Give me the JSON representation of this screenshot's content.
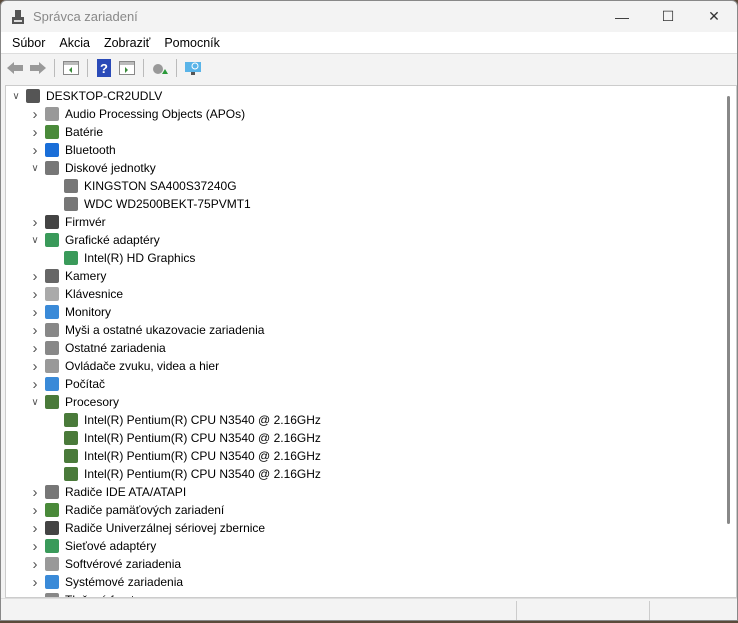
{
  "window": {
    "title": "Správca zariadení"
  },
  "menu": [
    "Súbor",
    "Akcia",
    "Zobraziť",
    "Pomocník"
  ],
  "toolbar": [
    "back-icon",
    "forward-icon",
    "show-hide-console-tree-icon",
    "help-icon",
    "action-pane-icon",
    "update-driver-icon",
    "scan-hardware-icon"
  ],
  "tree": [
    {
      "label": "DESKTOP-CR2UDLV",
      "level": 0,
      "exp": "open",
      "icon": "computer-icon",
      "color": "#555"
    },
    {
      "label": "Audio Processing Objects (APOs)",
      "level": 1,
      "exp": "closed",
      "icon": "speaker-icon",
      "color": "#999"
    },
    {
      "label": "Batérie",
      "level": 1,
      "exp": "closed",
      "icon": "battery-icon",
      "color": "#4a8a3a"
    },
    {
      "label": "Bluetooth",
      "level": 1,
      "exp": "closed",
      "icon": "bluetooth-icon",
      "color": "#1a6ed8"
    },
    {
      "label": "Diskové jednotky",
      "level": 1,
      "exp": "open",
      "icon": "disk-icon",
      "color": "#777"
    },
    {
      "label": "KINGSTON SA400S37240G",
      "level": 2,
      "exp": "",
      "icon": "disk-icon",
      "color": "#777"
    },
    {
      "label": "WDC WD2500BEKT-75PVMT1",
      "level": 2,
      "exp": "",
      "icon": "disk-icon",
      "color": "#777"
    },
    {
      "label": "Firmvér",
      "level": 1,
      "exp": "closed",
      "icon": "firmware-icon",
      "color": "#444"
    },
    {
      "label": "Grafické adaptéry",
      "level": 1,
      "exp": "open",
      "icon": "display-adapter-icon",
      "color": "#3a9a5a"
    },
    {
      "label": "Intel(R) HD Graphics",
      "level": 2,
      "exp": "",
      "icon": "display-adapter-icon",
      "color": "#3a9a5a"
    },
    {
      "label": "Kamery",
      "level": 1,
      "exp": "closed",
      "icon": "camera-icon",
      "color": "#666"
    },
    {
      "label": "Klávesnice",
      "level": 1,
      "exp": "closed",
      "icon": "keyboard-icon",
      "color": "#aaa"
    },
    {
      "label": "Monitory",
      "level": 1,
      "exp": "closed",
      "icon": "monitor-icon",
      "color": "#3a8ad8"
    },
    {
      "label": "Myši a ostatné ukazovacie zariadenia",
      "level": 1,
      "exp": "closed",
      "icon": "mouse-icon",
      "color": "#888"
    },
    {
      "label": "Ostatné zariadenia",
      "level": 1,
      "exp": "closed",
      "icon": "unknown-device-icon",
      "color": "#888"
    },
    {
      "label": "Ovládače zvuku, videa a hier",
      "level": 1,
      "exp": "closed",
      "icon": "speaker-icon",
      "color": "#999"
    },
    {
      "label": "Počítač",
      "level": 1,
      "exp": "closed",
      "icon": "monitor-icon",
      "color": "#3a8ad8"
    },
    {
      "label": "Procesory",
      "level": 1,
      "exp": "open",
      "icon": "cpu-icon",
      "color": "#4a7a3a"
    },
    {
      "label": "Intel(R) Pentium(R) CPU  N3540  @ 2.16GHz",
      "level": 2,
      "exp": "",
      "icon": "cpu-icon",
      "color": "#4a7a3a"
    },
    {
      "label": "Intel(R) Pentium(R) CPU  N3540  @ 2.16GHz",
      "level": 2,
      "exp": "",
      "icon": "cpu-icon",
      "color": "#4a7a3a"
    },
    {
      "label": "Intel(R) Pentium(R) CPU  N3540  @ 2.16GHz",
      "level": 2,
      "exp": "",
      "icon": "cpu-icon",
      "color": "#4a7a3a"
    },
    {
      "label": "Intel(R) Pentium(R) CPU  N3540  @ 2.16GHz",
      "level": 2,
      "exp": "",
      "icon": "cpu-icon",
      "color": "#4a7a3a"
    },
    {
      "label": "Radiče IDE ATA/ATAPI",
      "level": 1,
      "exp": "closed",
      "icon": "ide-controller-icon",
      "color": "#777"
    },
    {
      "label": "Radiče pamäťových zariadení",
      "level": 1,
      "exp": "closed",
      "icon": "storage-controller-icon",
      "color": "#4a8a3a"
    },
    {
      "label": "Radiče Univerzálnej sériovej zbernice",
      "level": 1,
      "exp": "closed",
      "icon": "usb-icon",
      "color": "#444"
    },
    {
      "label": "Sieťové adaptéry",
      "level": 1,
      "exp": "closed",
      "icon": "network-adapter-icon",
      "color": "#3a9a5a"
    },
    {
      "label": "Softvérové zariadenia",
      "level": 1,
      "exp": "closed",
      "icon": "software-device-icon",
      "color": "#999"
    },
    {
      "label": "Systémové zariadenia",
      "level": 1,
      "exp": "closed",
      "icon": "system-device-icon",
      "color": "#3a8ad8"
    },
    {
      "label": "Tlačové fronty",
      "level": 1,
      "exp": "closed",
      "icon": "printer-icon",
      "color": "#888"
    }
  ]
}
